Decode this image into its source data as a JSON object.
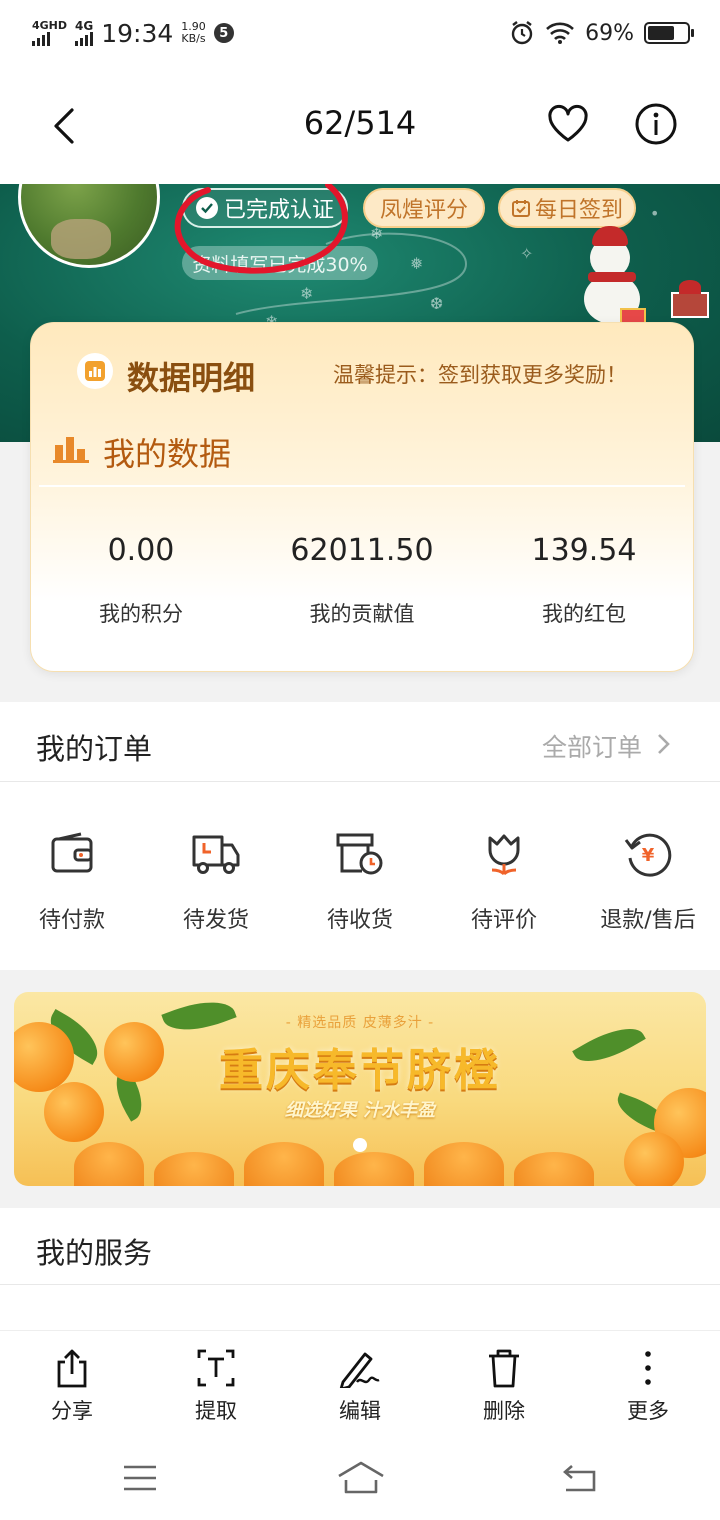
{
  "status_bar": {
    "net1": "4GHD",
    "net2": "4G",
    "time": "19:34",
    "speed_value": "1.90",
    "speed_unit": "KB/s",
    "notif_count": "5",
    "battery": "69%",
    "battery_level": 0.69
  },
  "nav": {
    "counter": "62/514"
  },
  "profile": {
    "verified_label": "已完成认证",
    "rating_label": "凤煌评分",
    "signin_label": "每日签到",
    "progress_label": "资料填写已完成30%"
  },
  "data_card": {
    "title": "数据明细",
    "tip": "温馨提示：签到获取更多奖励！",
    "section": "我的数据",
    "stats": [
      {
        "value": "0.00",
        "label": "我的积分"
      },
      {
        "value": "62011.50",
        "label": "我的贡献值"
      },
      {
        "value": "139.54",
        "label": "我的红包"
      }
    ]
  },
  "orders": {
    "title": "我的订单",
    "all_label": "全部订单",
    "items": [
      {
        "label": "待付款",
        "icon": "wallet-icon"
      },
      {
        "label": "待发货",
        "icon": "truck-icon"
      },
      {
        "label": "待收货",
        "icon": "box-clock-icon"
      },
      {
        "label": "待评价",
        "icon": "tulip-icon"
      },
      {
        "label": "退款/售后",
        "icon": "refund-icon"
      }
    ]
  },
  "promo": {
    "subtitle": "- 精选品质 皮薄多汁 -",
    "title": "重庆奉节脐橙",
    "slogan": "细选好果 汁水丰盈"
  },
  "services": {
    "title": "我的服务"
  },
  "toolbar": {
    "share": "分享",
    "extract": "提取",
    "edit": "编辑",
    "delete": "删除",
    "more": "更多"
  },
  "colors": {
    "banner": "#0e5e4c",
    "card_title": "#8a4f10",
    "accent_orange": "#f0632a"
  }
}
